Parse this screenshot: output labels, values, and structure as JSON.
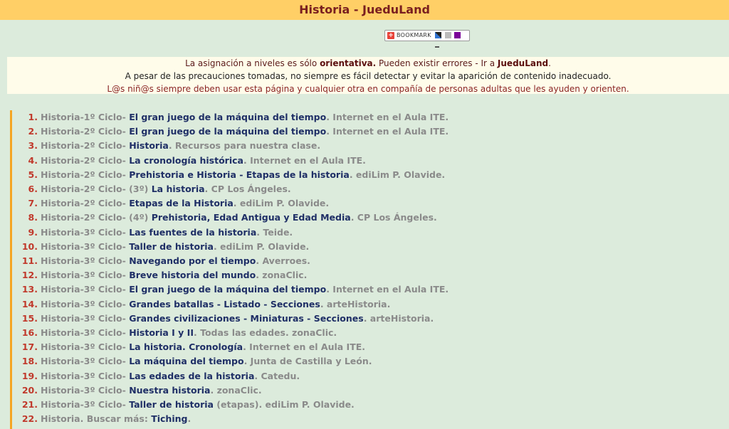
{
  "header": {
    "title": "Historia - JueduLand"
  },
  "bookmark": {
    "label": "BOOKMARK"
  },
  "notice": {
    "line1_a": "La asignación a niveles es sólo ",
    "line1_b": "orientativa.",
    "line1_c": " Pueden existir errores -  Ir a ",
    "line1_link": "JueduLand",
    "line1_end": ".",
    "line2": "A pesar de las precauciones tomadas, no siempre es fácil detectar y evitar la aparición de contenido inadecuado.",
    "line3": "L@s niñ@s siempre deben usar esta página y cualquier otra en compañía de personas adultas que les ayuden y orienten."
  },
  "items": [
    {
      "n": "1.",
      "prefix": "Historia-1º Ciclo- ",
      "link": "El gran juego de la máquina del tiempo",
      "suffix": ". Internet en el Aula ITE."
    },
    {
      "n": "2.",
      "prefix": "Historia-2º Ciclo- ",
      "link": "El gran juego de la máquina del tiempo",
      "suffix": ". Internet en el Aula ITE."
    },
    {
      "n": "3.",
      "prefix": "Historia-2º Ciclo- ",
      "link": "Historia",
      "suffix": ". Recursos para nuestra clase."
    },
    {
      "n": "4.",
      "prefix": "Historia-2º Ciclo- ",
      "link": "La cronología histórica",
      "suffix": ". Internet en el Aula ITE."
    },
    {
      "n": "5.",
      "prefix": "Historia-2º Ciclo- ",
      "link": "Prehistoria e Historia - Etapas de la historia",
      "suffix": ". ediLim P. Olavide."
    },
    {
      "n": "6.",
      "prefix": "Historia-2º Ciclo- (3º) ",
      "link": "La historia",
      "suffix": ". CP Los Ángeles."
    },
    {
      "n": "7.",
      "prefix": "Historia-2º Ciclo- ",
      "link": "Etapas de la Historia",
      "suffix": ". ediLim P. Olavide."
    },
    {
      "n": "8.",
      "prefix": "Historia-2º Ciclo- (4º) ",
      "link": "Prehistoria, Edad Antigua y Edad Media",
      "suffix": ". CP Los Ángeles."
    },
    {
      "n": "9.",
      "prefix": "Historia-3º Ciclo- ",
      "link": "Las fuentes de la historia",
      "suffix": ". Teide."
    },
    {
      "n": "10.",
      "prefix": "Historia-3º Ciclo- ",
      "link": "Taller de historia",
      "suffix": ". ediLim P. Olavide."
    },
    {
      "n": "11.",
      "prefix": "Historia-3º Ciclo- ",
      "link": "Navegando por el tiempo",
      "suffix": ". Averroes."
    },
    {
      "n": "12.",
      "prefix": "Historia-3º Ciclo- ",
      "link": "Breve historia del mundo",
      "suffix": ". zonaClic."
    },
    {
      "n": "13.",
      "prefix": "Historia-3º Ciclo- ",
      "link": "El gran juego de la máquina del tiempo",
      "suffix": ". Internet en el Aula ITE."
    },
    {
      "n": "14.",
      "prefix": "Historia-3º Ciclo- ",
      "link": "Grandes batallas - Listado - Secciones",
      "suffix": ". arteHistoria."
    },
    {
      "n": "15.",
      "prefix": "Historia-3º Ciclo- ",
      "link": "Grandes civilizaciones - Miniaturas - Secciones",
      "suffix": ". arteHistoria."
    },
    {
      "n": "16.",
      "prefix": "Historia-3º Ciclo- ",
      "link": "Historia I y II",
      "suffix": ". Todas las edades. zonaClic."
    },
    {
      "n": "17.",
      "prefix": "Historia-3º Ciclo- ",
      "link": "La historia. Cronología",
      "suffix": ". Internet en el Aula ITE."
    },
    {
      "n": "18.",
      "prefix": "Historia-3º Ciclo- ",
      "link": "La máquina del tiempo",
      "suffix": ". Junta de Castilla y León."
    },
    {
      "n": "19.",
      "prefix": "Historia-3º Ciclo- ",
      "link": "Las edades de la historia",
      "suffix": ". Catedu."
    },
    {
      "n": "20.",
      "prefix": "Historia-3º Ciclo- ",
      "link": "Nuestra historia",
      "suffix": ". zonaClic."
    },
    {
      "n": "21.",
      "prefix": "Historia-3º Ciclo- ",
      "link": "Taller de historia",
      "suffix": " (etapas). ediLim P. Olavide."
    },
    {
      "n": "22.",
      "prefix": "Historia. Buscar más: ",
      "link": "Tiching",
      "suffix": "."
    }
  ]
}
